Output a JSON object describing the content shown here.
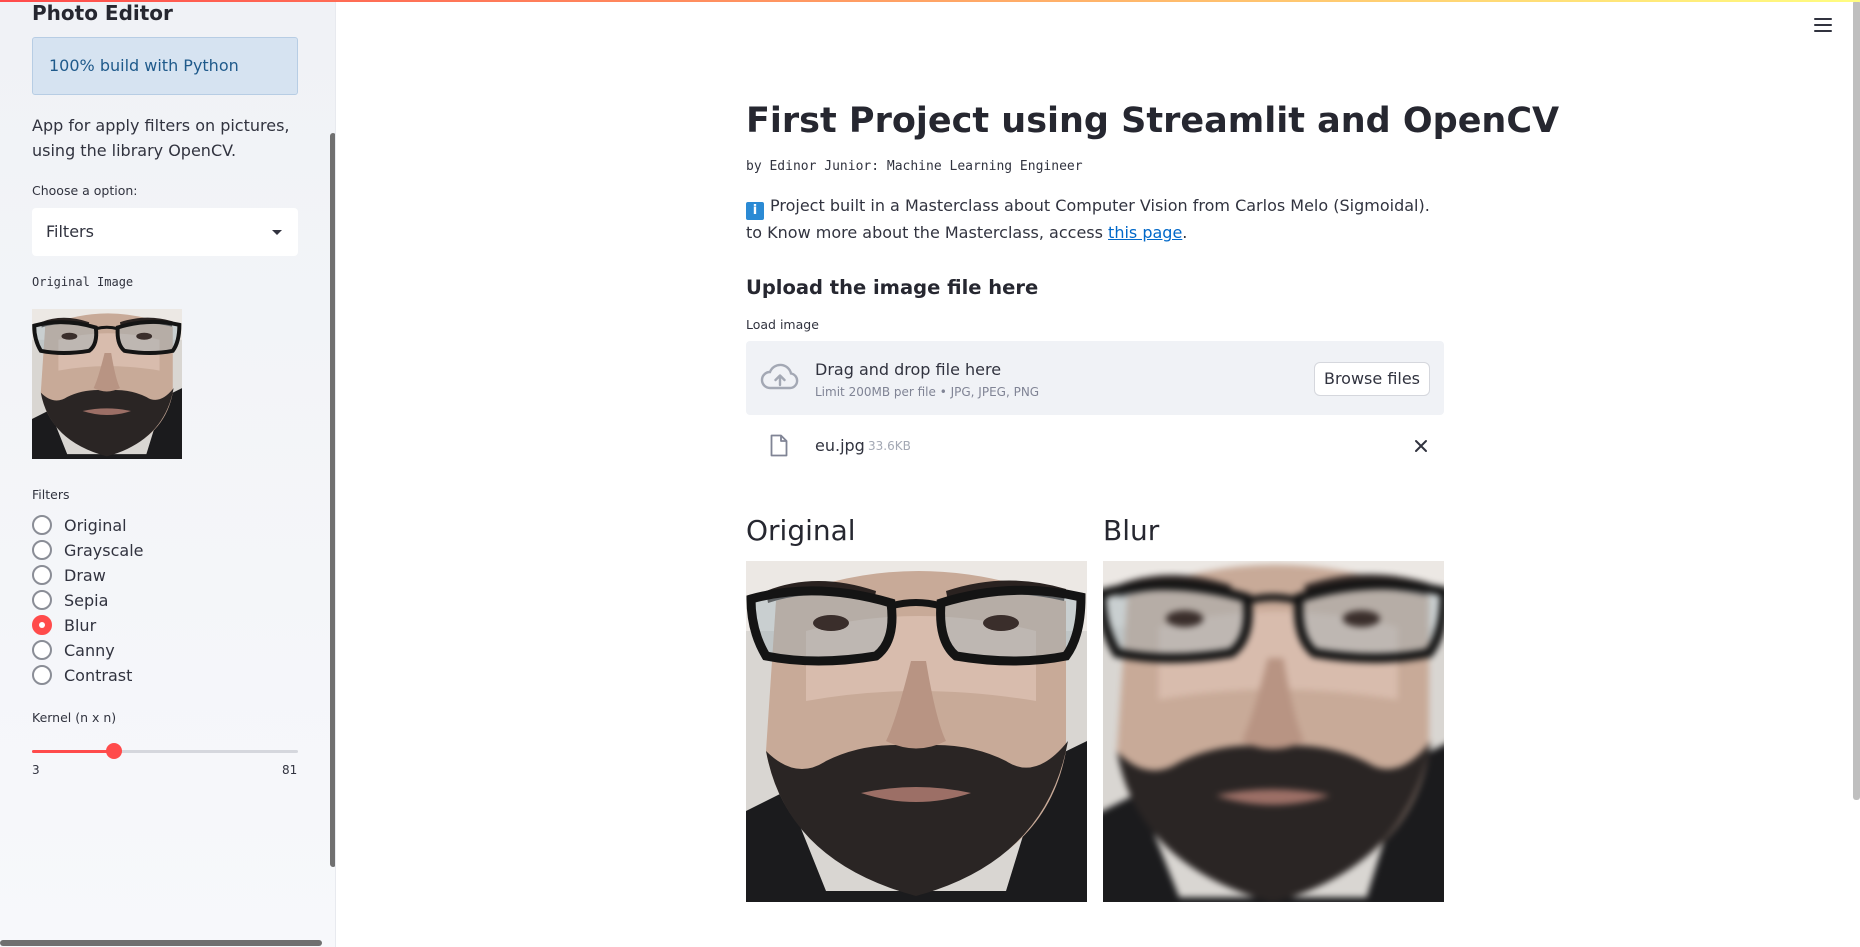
{
  "sidebar": {
    "title": "Photo Editor",
    "info_text": "100% build with Python",
    "description": "App for apply filters on pictures, using the library OpenCV.",
    "option_label": "Choose a option:",
    "option_value": "Filters",
    "original_image_caption": "Original Image",
    "filters_label": "Filters",
    "filters": [
      {
        "label": "Original",
        "selected": false
      },
      {
        "label": "Grayscale",
        "selected": false
      },
      {
        "label": "Draw",
        "selected": false
      },
      {
        "label": "Sepia",
        "selected": false
      },
      {
        "label": "Blur",
        "selected": true
      },
      {
        "label": "Canny",
        "selected": false
      },
      {
        "label": "Contrast",
        "selected": false
      }
    ],
    "kernel_label": "Kernel (n x n)",
    "kernel_min": "3",
    "kernel_max": "81",
    "kernel_fraction": 0.31
  },
  "main": {
    "title": "First Project using Streamlit and OpenCV",
    "byline": "by Edinor Junior: Machine Learning Engineer",
    "info_icon": "i",
    "info_text_before": "Project built in a Masterclass about Computer Vision from Carlos Melo (Sigmoidal). to Know more about the Masterclass, access ",
    "info_link": "this page",
    "info_text_after": ".",
    "upload_heading": "Upload the image file here",
    "uploader_label": "Load image",
    "dropzone_title": "Drag and drop file here",
    "dropzone_subtitle": "Limit 200MB per file • JPG, JPEG, PNG",
    "browse_label": "Browse files",
    "file_name": "eu.jpg",
    "file_size": "33.6KB",
    "original_title": "Original",
    "result_title": "Blur"
  },
  "icons": {
    "menu": "hamburger-menu-icon",
    "upload": "cloud-upload-icon",
    "file": "file-icon",
    "close": "close-icon"
  },
  "colors": {
    "accent": "#ff4b4b",
    "info_bg": "#d6e3f1",
    "info_text": "#1f5a8b",
    "link": "#0068c9"
  }
}
